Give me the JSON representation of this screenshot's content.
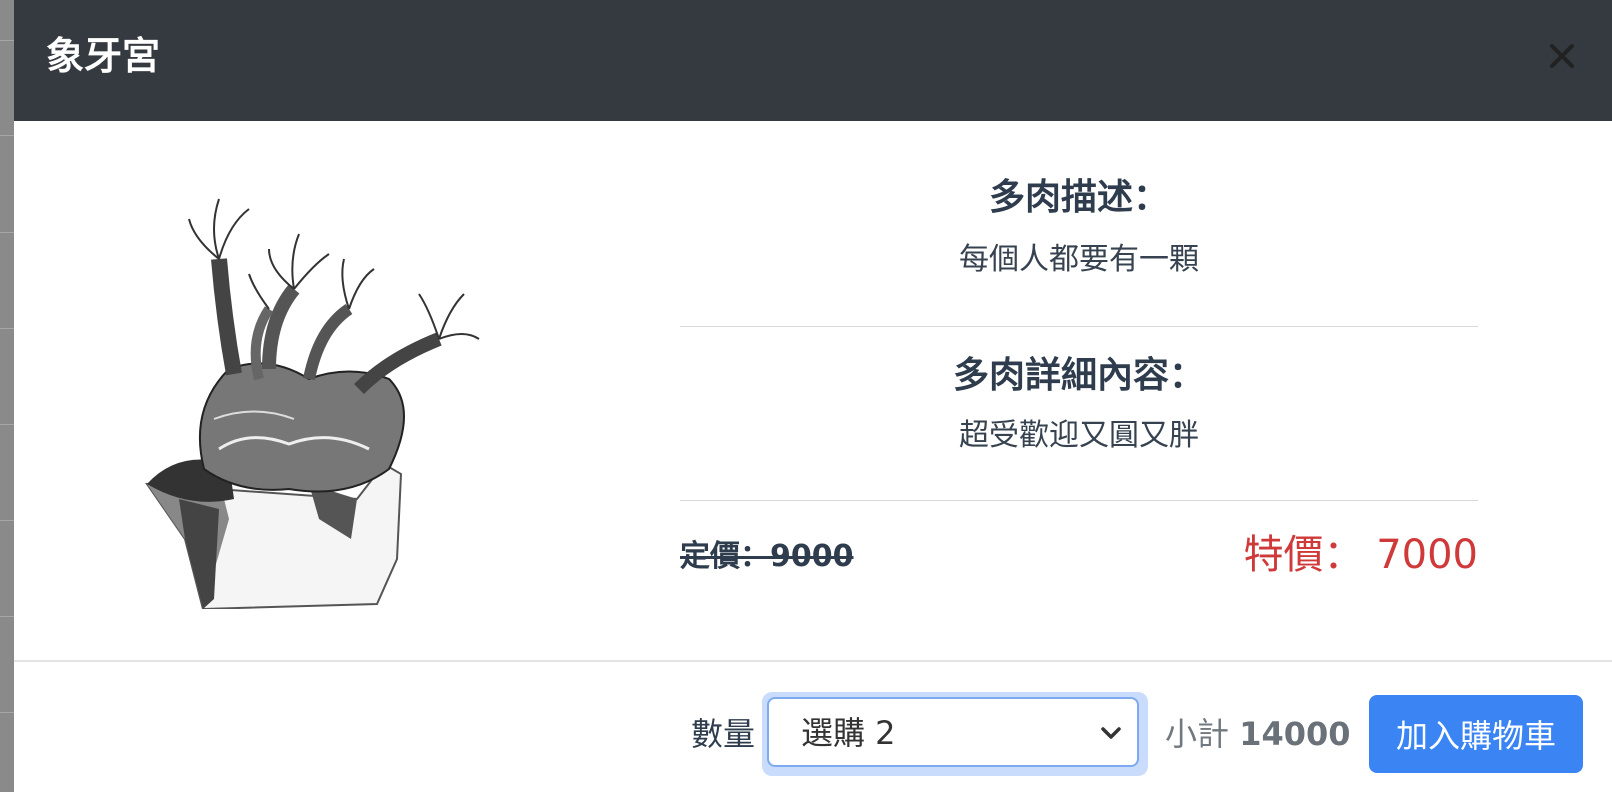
{
  "modal": {
    "title": "象牙宮",
    "close_icon": "close-icon"
  },
  "product": {
    "image_icon": "succulent-plant-illustration",
    "description_heading": "多肉描述：",
    "description_text": "每個人都要有一顆",
    "detail_heading": "多肉詳細內容：",
    "detail_text": "超受歡迎又圓又胖",
    "original_price_label": "定價：",
    "original_price": "9000",
    "sale_price_label": "特價：",
    "sale_price": "7000"
  },
  "footer": {
    "quantity_label": "數量",
    "quantity_selected": "選購 2",
    "subtotal_label": "小計",
    "subtotal_value": "14000",
    "add_to_cart_label": "加入購物車"
  },
  "colors": {
    "header_bg": "#343a40",
    "sale_price": "#d0393a",
    "primary_button": "#3a84f4"
  }
}
